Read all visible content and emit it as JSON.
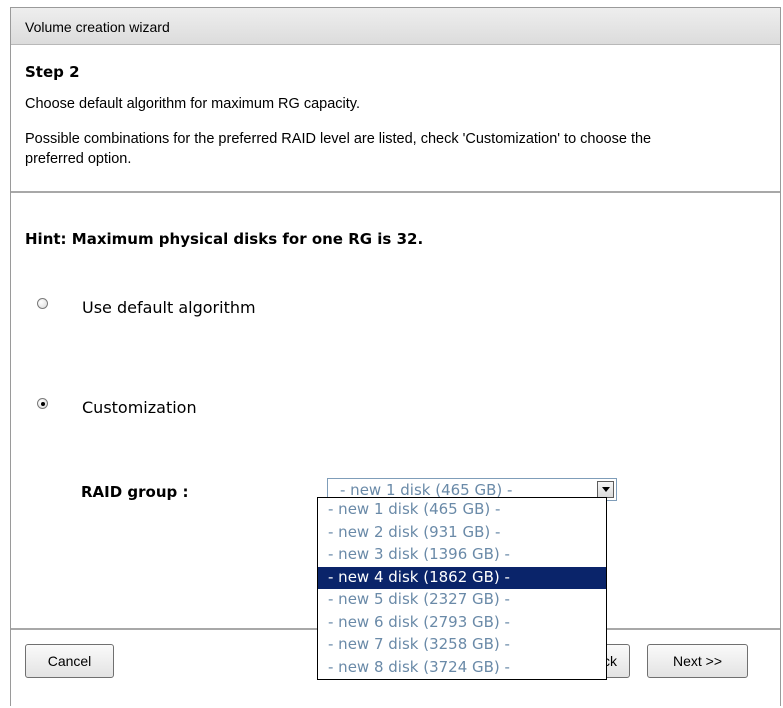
{
  "window": {
    "title": "Volume creation wizard"
  },
  "step": {
    "title": "Step 2",
    "description1": "Choose default algorithm for maximum RG capacity.",
    "description2": "Possible combinations for the preferred RAID level are listed, check 'Customization' to choose the preferred option."
  },
  "hint": "Hint: Maximum physical disks for one RG is 32.",
  "options": {
    "default": {
      "label": "Use default algorithm",
      "checked": false
    },
    "custom": {
      "label": "Customization",
      "checked": true
    }
  },
  "raid_group": {
    "label": "RAID group :",
    "selected_value": "- new 1 disk (465 GB) -",
    "highlighted_index": 3,
    "options": [
      "- new 1 disk (465 GB) -",
      "- new 2 disk (931 GB) -",
      "- new 3 disk (1396 GB) -",
      "- new 4 disk (1862 GB) -",
      "- new 5 disk (2327 GB) -",
      "- new 6 disk (2793 GB) -",
      "- new 7 disk (3258 GB) -",
      "- new 8 disk (3724 GB) -"
    ]
  },
  "buttons": {
    "cancel": "Cancel",
    "back": "<< Back",
    "next": "Next >>"
  },
  "colors": {
    "option_text": "#6a8aa8",
    "highlight_bg": "#0a246a"
  }
}
